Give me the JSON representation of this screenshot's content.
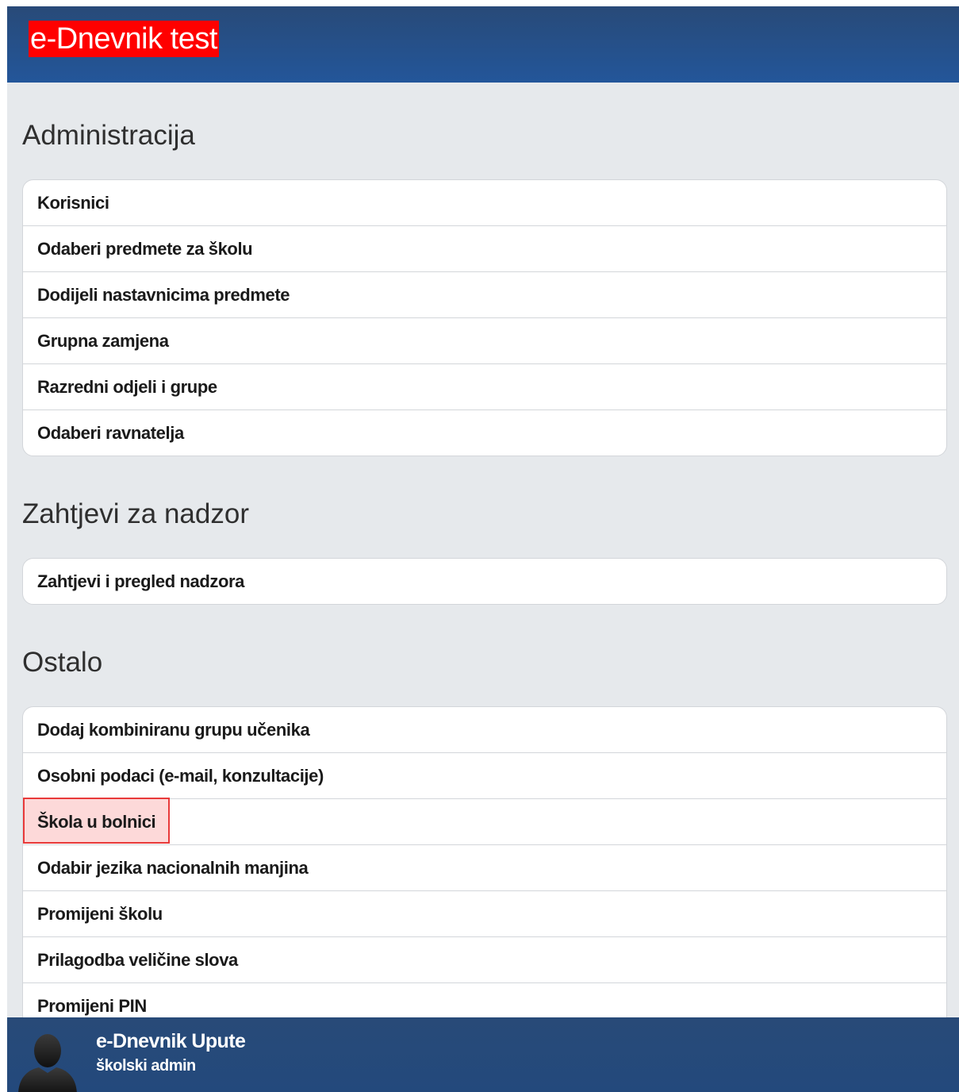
{
  "header": {
    "title": "e-Dnevnik test"
  },
  "sections": {
    "administracija": {
      "heading": "Administracija",
      "items": [
        "Korisnici",
        "Odaberi predmete za školu",
        "Dodijeli nastavnicima predmete",
        "Grupna zamjena",
        "Razredni odjeli i grupe",
        "Odaberi ravnatelja"
      ]
    },
    "nadzor": {
      "heading": "Zahtjevi za nadzor",
      "items": [
        "Zahtjevi i pregled nadzora"
      ]
    },
    "ostalo": {
      "heading": "Ostalo",
      "items": [
        "Dodaj kombiniranu grupu učenika",
        "Osobni podaci (e-mail, konzultacije)",
        "Škola u bolnici",
        "Odabir jezika nacionalnih manjina",
        "Promijeni školu",
        "Prilagodba veličine slova",
        "Promijeni PIN"
      ],
      "highlighted_item": "Škola u bolnici"
    }
  },
  "footer": {
    "name": "e-Dnevnik Upute",
    "role": "školski admin",
    "avatar_icon": "user-silhouette-icon"
  },
  "colors": {
    "header_bg": "#23569a",
    "title_highlight": "#ff0000",
    "page_bg": "#e6e9ec",
    "highlight_fill": "#fdd9d9",
    "highlight_border": "#e83a3a"
  }
}
